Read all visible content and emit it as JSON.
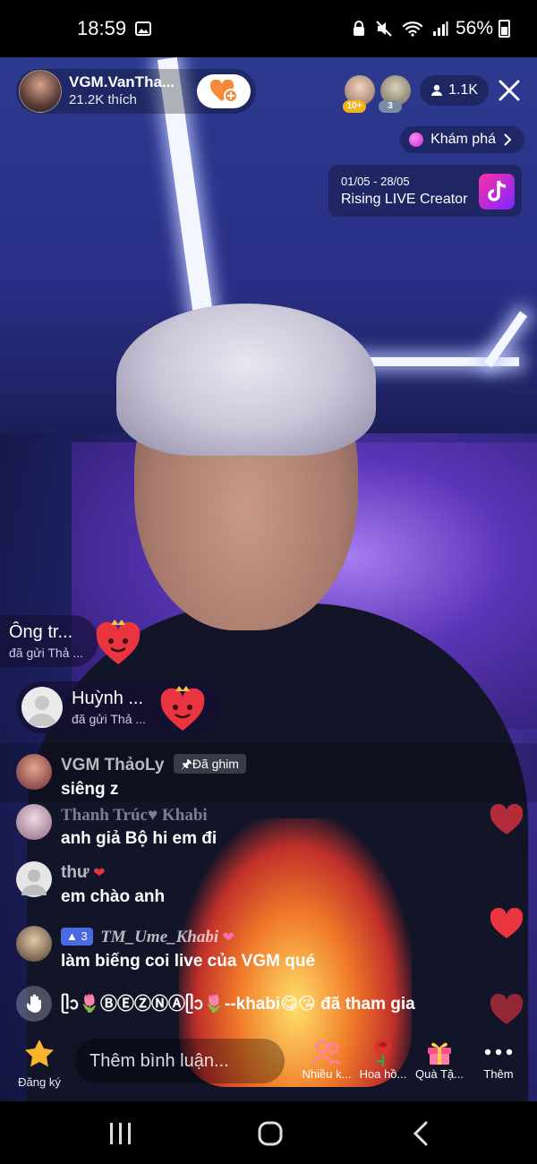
{
  "status_bar": {
    "time": "18:59",
    "battery": "56%",
    "icons": [
      "image-icon",
      "face-lock-icon",
      "mute-icon",
      "wifi-icon",
      "signal-icon",
      "battery-icon"
    ]
  },
  "host": {
    "name": "VGM.VanTha...",
    "likes": "21.2K thích"
  },
  "viewers": {
    "badge_1": "10+",
    "badge_2": "3",
    "count": "1.1K"
  },
  "explore": {
    "label": "Khám phá"
  },
  "creator_card": {
    "dates": "01/05 - 28/05",
    "title": "Rising LIVE Creator"
  },
  "gifts": [
    {
      "name": "Ông  tr...",
      "sub": "đã gửi Thả ..."
    },
    {
      "name": "Huỳnh ...",
      "sub": "đã gửi Thả ..."
    }
  ],
  "comments": [
    {
      "user": "VGM   ThảoLy",
      "badge": "Đã ghim",
      "text": "siêng z"
    },
    {
      "user": "Thanh Trúc♥ Khabi",
      "text": "anh giả Bộ hi em đi"
    },
    {
      "user": "thư",
      "text": "em chào anh"
    },
    {
      "level": "3",
      "user": "TM_Ume_Khabi",
      "text": "làm biếng coi live của VGM qué"
    }
  ],
  "join": {
    "text": "ᥫᩣ🌷ⒷⒺⓏⓃⒶᥫᩣ🌷--khabi😋😘 đã tham gia"
  },
  "bottom_bar": {
    "subscribe_label": "Đăng ký",
    "comment_placeholder": "Thêm bình luận...",
    "actions": [
      {
        "label": "Nhiều k..."
      },
      {
        "label": "Hoa hồ..."
      },
      {
        "label": "Quà Tặ..."
      },
      {
        "label": "Thêm"
      }
    ]
  },
  "colors": {
    "heart_red": "#e8353f",
    "follow_orange": "#f58a3b",
    "rose_icon": "#d9322e",
    "gift_icon": "#ff4f8b",
    "level_badge": "#4a6be0"
  }
}
